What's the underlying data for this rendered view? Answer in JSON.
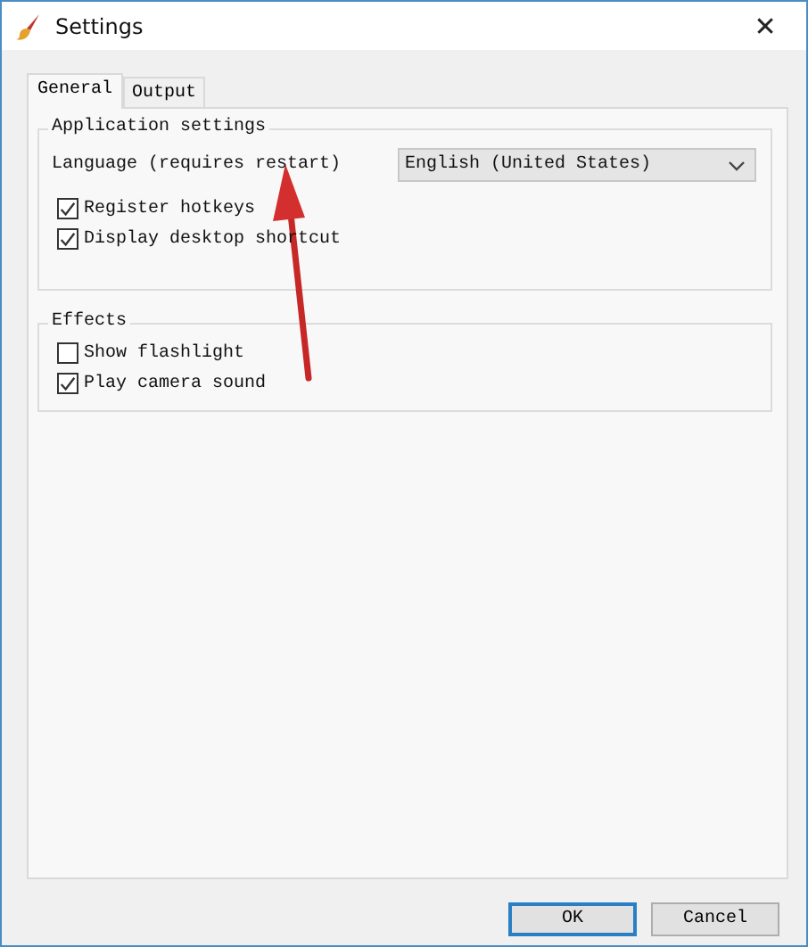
{
  "window": {
    "title": "Settings",
    "close": "✕"
  },
  "tabs": [
    {
      "label": "General",
      "selected": true
    },
    {
      "label": "Output",
      "selected": false
    }
  ],
  "groups": [
    {
      "title": "Application settings",
      "language": {
        "label": "Language (requires restart)",
        "value": "English (United States)"
      },
      "options": [
        {
          "label": "Register hotkeys",
          "checked": true
        },
        {
          "label": "Display desktop shortcut",
          "checked": true
        }
      ]
    },
    {
      "title": "Effects",
      "options": [
        {
          "label": "Show flashlight",
          "checked": false
        },
        {
          "label": "Play camera sound",
          "checked": true
        }
      ]
    }
  ],
  "buttons": [
    {
      "label": "OK",
      "default": true
    },
    {
      "label": "Cancel",
      "default": false
    }
  ]
}
